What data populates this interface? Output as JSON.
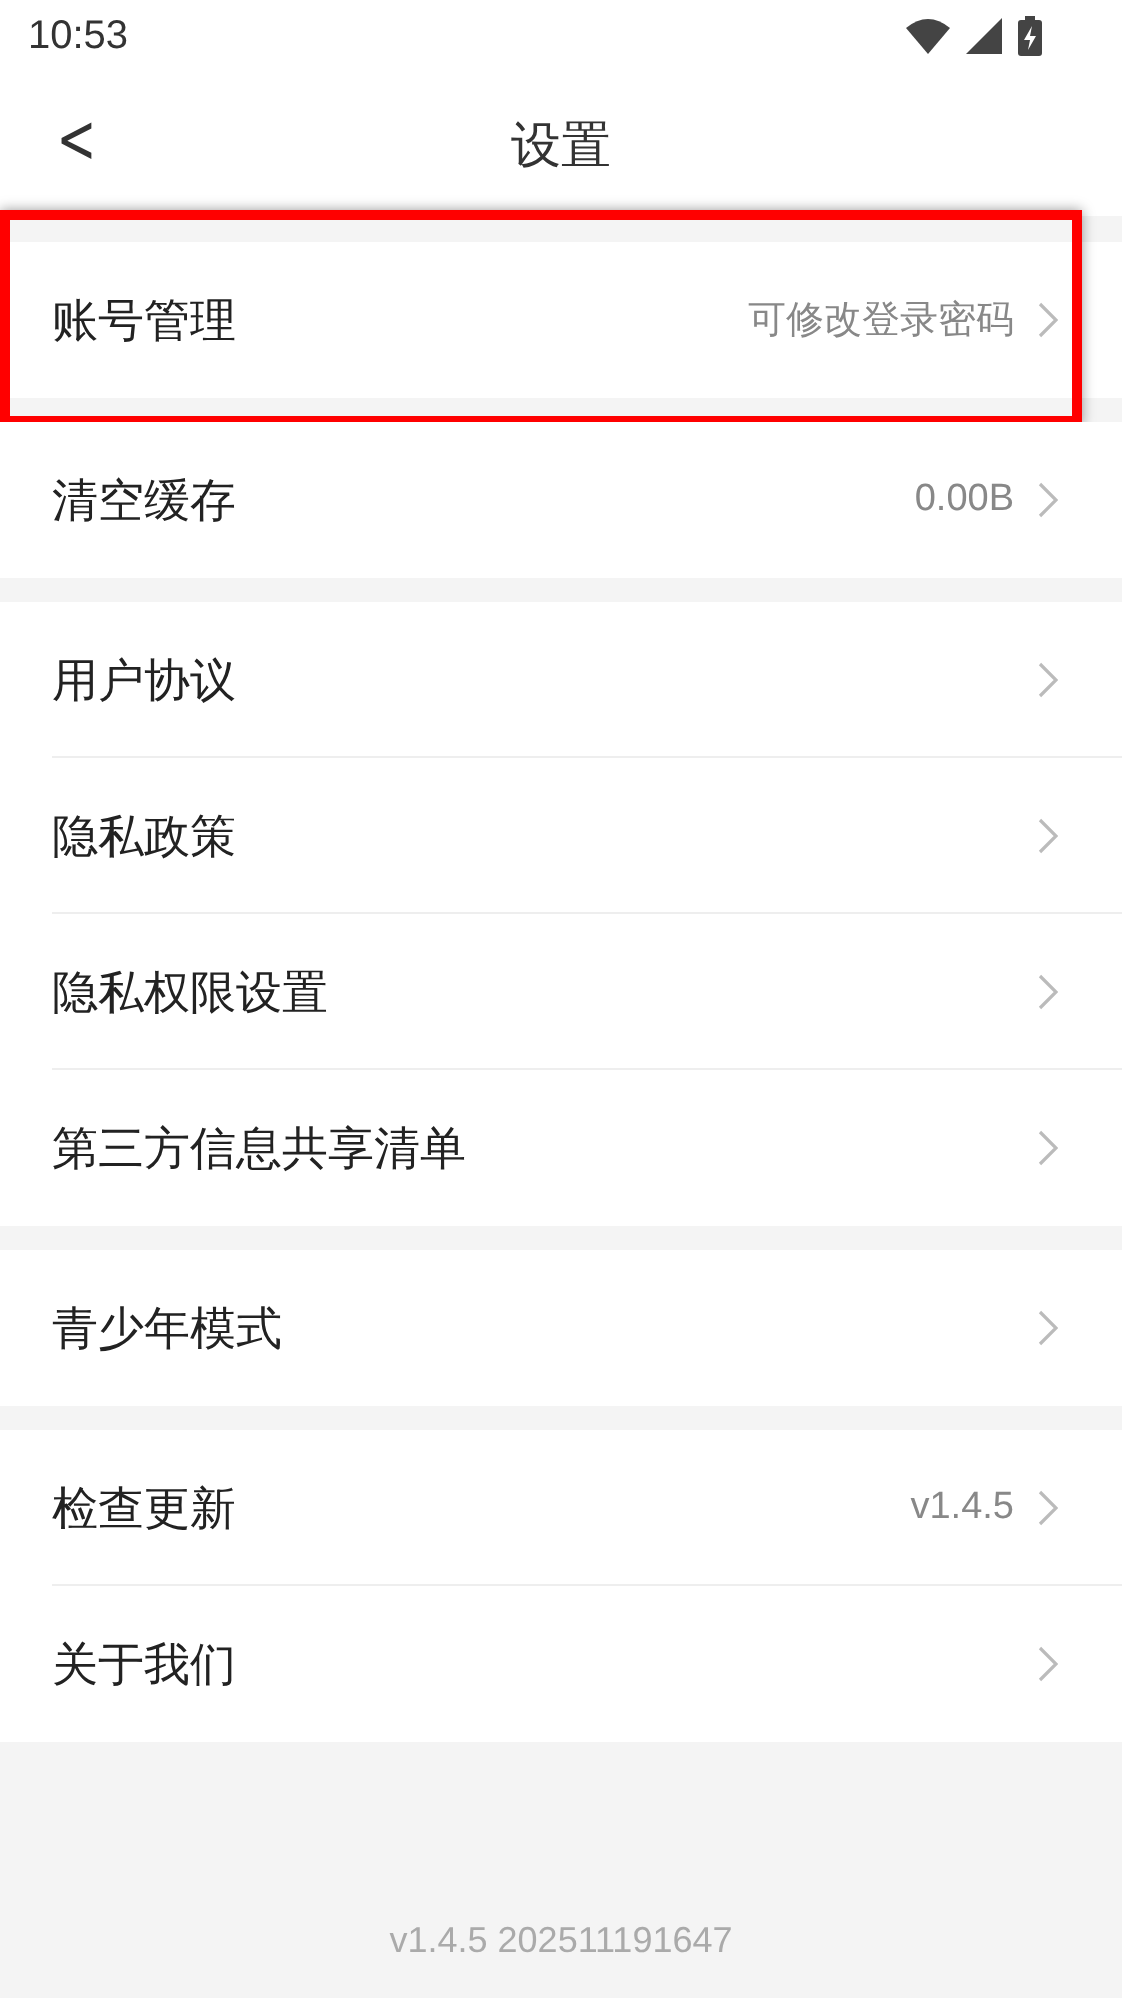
{
  "status_bar": {
    "time": "10:53"
  },
  "header": {
    "back": "<",
    "title": "设置"
  },
  "groups": [
    {
      "rows": [
        {
          "label": "账号管理",
          "value": "可修改登录密码",
          "highlighted": true
        }
      ]
    },
    {
      "rows": [
        {
          "label": "清空缓存",
          "value": "0.00B",
          "highlighted": false
        }
      ]
    },
    {
      "rows": [
        {
          "label": "用户协议",
          "highlighted": false
        },
        {
          "label": "隐私政策",
          "highlighted": false
        },
        {
          "label": "隐私权限设置",
          "highlighted": false
        },
        {
          "label": "第三方信息共享清单",
          "highlighted": false
        }
      ]
    },
    {
      "rows": [
        {
          "label": "青少年模式",
          "highlighted": false
        }
      ]
    },
    {
      "rows": [
        {
          "label": "检查更新",
          "value": "v1.4.5",
          "highlighted": false
        },
        {
          "label": "关于我们",
          "highlighted": false
        }
      ]
    }
  ],
  "footer": {
    "version": "v1.4.5 202511191647"
  }
}
